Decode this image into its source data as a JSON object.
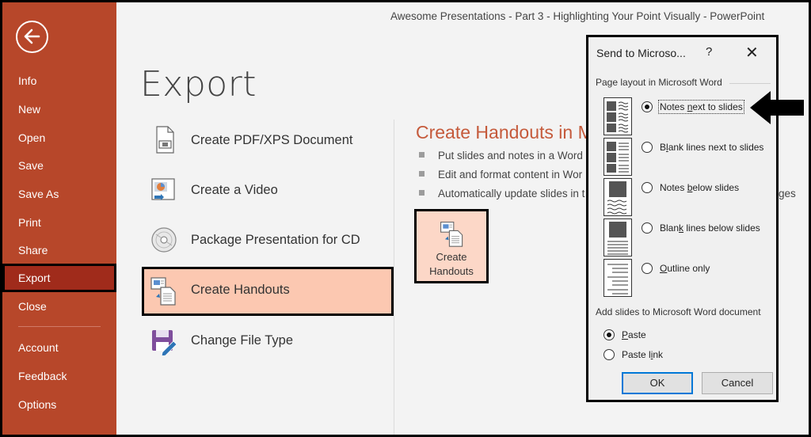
{
  "window": {
    "title": "Awesome Presentations - Part 3 - Highlighting Your Point Visually  -  PowerPoint"
  },
  "sidebar": {
    "back_icon": "back-arrow-icon",
    "items": [
      {
        "label": "Info"
      },
      {
        "label": "New"
      },
      {
        "label": "Open"
      },
      {
        "label": "Save"
      },
      {
        "label": "Save As"
      },
      {
        "label": "Print"
      },
      {
        "label": "Share"
      },
      {
        "label": "Export",
        "active": true
      },
      {
        "label": "Close"
      },
      {
        "label": "Account"
      },
      {
        "label": "Feedback"
      },
      {
        "label": "Options"
      }
    ]
  },
  "export": {
    "title": "Export",
    "options": [
      {
        "label": "Create PDF/XPS Document",
        "icon": "pdf-document-icon"
      },
      {
        "label": "Create a Video",
        "icon": "video-icon"
      },
      {
        "label": "Package Presentation for CD",
        "icon": "cd-icon"
      },
      {
        "label": "Create Handouts",
        "icon": "handouts-icon",
        "selected": true
      },
      {
        "label": "Change File Type",
        "icon": "file-type-icon"
      }
    ]
  },
  "handouts": {
    "heading": "Create Handouts in M",
    "bullets": [
      "Put slides and notes in a Word",
      "Edit and format content in Wor",
      "Automatically update slides in t"
    ],
    "trailing_text": "ges",
    "button_line1": "Create",
    "button_line2": "Handouts"
  },
  "dialog": {
    "title": "Send to Microso...",
    "help": "?",
    "close": "✕",
    "page_layout_label": "Page layout in Microsoft Word",
    "layouts": [
      {
        "label": "Notes next to slides",
        "selected": true
      },
      {
        "label": "Blank lines next to slides",
        "selected": false
      },
      {
        "label": "Notes below slides",
        "selected": false
      },
      {
        "label": "Blank lines below slides",
        "selected": false
      },
      {
        "label": "Outline only",
        "selected": false
      }
    ],
    "add_slides_label": "Add slides to Microsoft Word document",
    "add_options": [
      {
        "label": "Paste",
        "selected": true
      },
      {
        "label": "Paste link",
        "selected": false
      }
    ],
    "ok_label": "OK",
    "cancel_label": "Cancel"
  },
  "colors": {
    "sidebar": "#b7472a",
    "sidebar_active": "#a02b1b",
    "selected_option": "#fcc8b1",
    "heading": "#c55a3b"
  }
}
